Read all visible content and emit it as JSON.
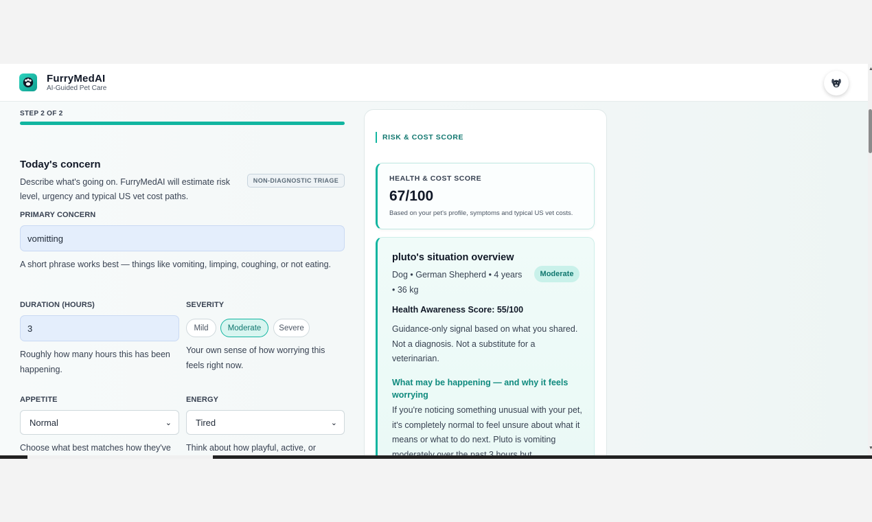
{
  "header": {
    "brand": "FurryMedAI",
    "tagline": "AI-Guided Pet Care"
  },
  "form": {
    "step_label": "STEP 2 OF 2",
    "progress": 1.0,
    "section_title": "Today's concern",
    "section_desc": "Describe what's going on. FurryMedAI will estimate risk level, urgency and typical US vet cost paths.",
    "triage_badge": "NON-DIAGNOSTIC TRIAGE",
    "primary_concern": {
      "label": "PRIMARY CONCERN",
      "value": "vomitting",
      "helper": "A short phrase works best — things like vomiting, limping, coughing, or not eating."
    },
    "duration": {
      "label": "DURATION (HOURS)",
      "value": "3",
      "helper": "Roughly how many hours this has been happening."
    },
    "severity": {
      "label": "SEVERITY",
      "options": [
        "Mild",
        "Moderate",
        "Severe"
      ],
      "selected": "Moderate",
      "helper": "Your own sense of how worrying this feels right now."
    },
    "appetite": {
      "label": "APPETITE",
      "value": "Normal",
      "helper": "Choose what best matches how they've"
    },
    "energy": {
      "label": "ENERGY",
      "value": "Tired",
      "helper": "Think about how playful, active, or"
    }
  },
  "panel": {
    "heading": "RISK & COST SCORE",
    "score_card": {
      "label": "HEALTH & COST SCORE",
      "value": "67/100",
      "note": "Based on your pet's profile, symptoms and typical US vet costs."
    },
    "overview": {
      "title": "pluto's situation overview",
      "subtitle": "Dog • German Shepherd • 4 years • 36 kg",
      "badge": "Moderate",
      "awareness": "Health Awareness Score: 55/100",
      "guidance": "Guidance-only signal based on what you shared. Not a diagnosis. Not a substitute for a veterinarian.",
      "heading": "What may be happening — and why it feels worrying",
      "body": "If you're noticing something unusual with your pet, it's completely normal to feel unsure about what it means or what to do next. Pluto is vomiting moderately over the past 3 hours but"
    }
  },
  "colors": {
    "accent": "#11b5a0",
    "accent_dark": "#0f766e",
    "input_bg": "#e4eefc"
  },
  "icons": {
    "logo": "paw-icon",
    "avatar": "dog-avatar-icon"
  }
}
